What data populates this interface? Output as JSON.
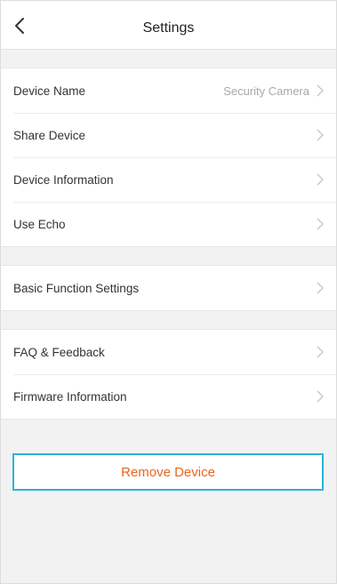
{
  "header": {
    "title": "Settings",
    "back_icon": "chevron-left-icon"
  },
  "groups": [
    {
      "items": [
        {
          "label": "Device Name",
          "value": "Security Camera"
        },
        {
          "label": "Share Device",
          "value": ""
        },
        {
          "label": "Device Information",
          "value": ""
        },
        {
          "label": "Use Echo",
          "value": ""
        }
      ]
    },
    {
      "items": [
        {
          "label": "Basic Function Settings",
          "value": ""
        }
      ]
    },
    {
      "items": [
        {
          "label": "FAQ & Feedback",
          "value": ""
        },
        {
          "label": "Firmware Information",
          "value": ""
        }
      ]
    }
  ],
  "remove_button": {
    "label": "Remove Device"
  },
  "colors": {
    "accent_orange": "#e8661e",
    "highlight_border": "#2bb3d8",
    "background": "#f2f2f2"
  },
  "icons": {
    "row_arrow": "chevron-right-icon"
  }
}
